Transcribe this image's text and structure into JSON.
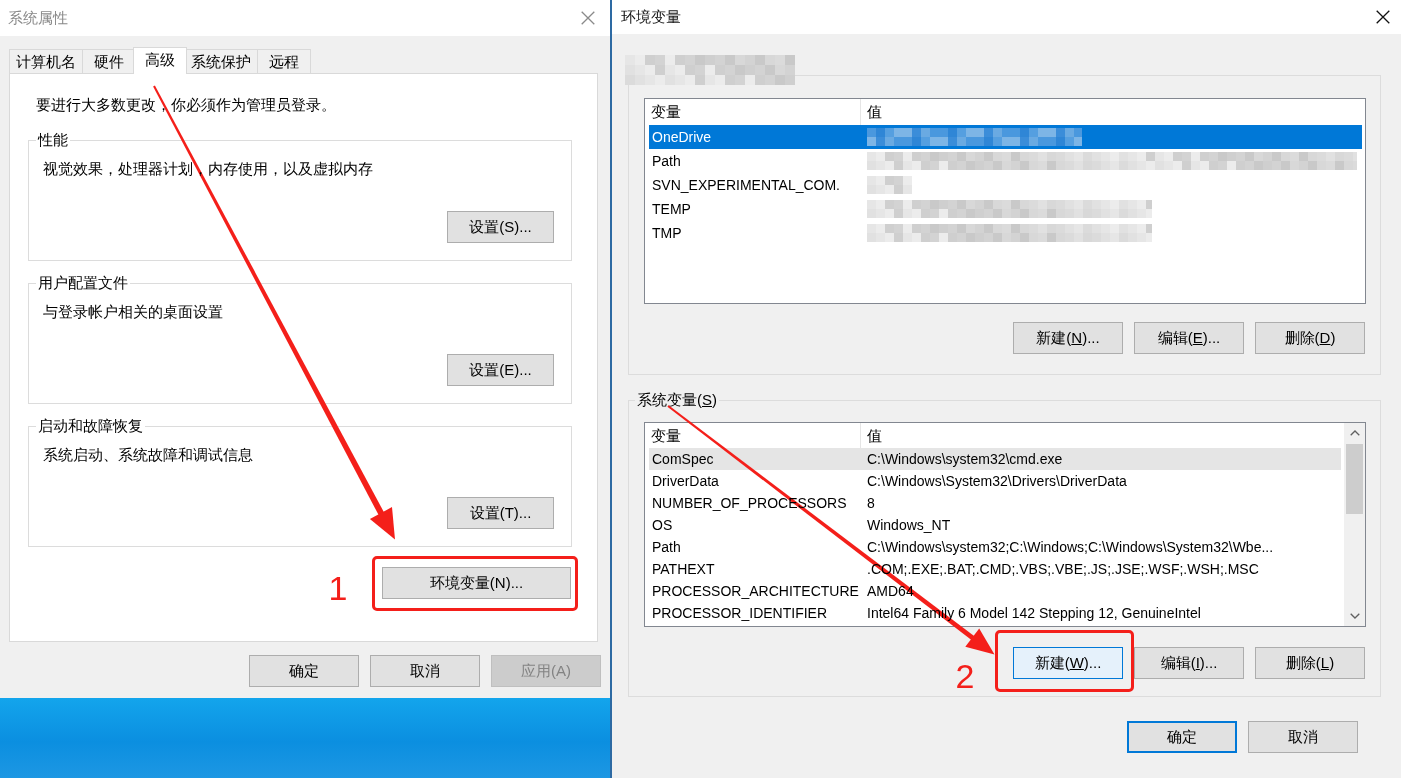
{
  "system_properties": {
    "title": "系统属性",
    "active": false,
    "tabs": [
      {
        "label": "计算机名",
        "selected": false
      },
      {
        "label": "硬件",
        "selected": false
      },
      {
        "label": "高级",
        "selected": true
      },
      {
        "label": "系统保护",
        "selected": false
      },
      {
        "label": "远程",
        "selected": false
      }
    ],
    "admin_notice": "要进行大多数更改，你必须作为管理员登录。",
    "groups": [
      {
        "title": "性能",
        "description": "视觉效果，处理器计划，内存使用，以及虚拟内存",
        "button": "设置(S)..."
      },
      {
        "title": "用户配置文件",
        "description": "与登录帐户相关的桌面设置",
        "button": "设置(E)..."
      },
      {
        "title": "启动和故障恢复",
        "description": "系统启动、系统故障和调试信息",
        "button": "设置(T)..."
      }
    ],
    "env_button": {
      "label": "环境变量(N)...",
      "callout": "1"
    },
    "buttons": [
      {
        "label": "确定",
        "disabled": false
      },
      {
        "label": "取消",
        "disabled": false
      },
      {
        "label": "应用(A)",
        "disabled": true
      }
    ]
  },
  "environment_variables": {
    "title": "环境变量",
    "active": true,
    "user_variables": {
      "legend_redacted": true,
      "focused": true,
      "columns": [
        "变量",
        "值"
      ],
      "rows": [
        {
          "name": "OneDrive",
          "value_redacted": true,
          "selected": true
        },
        {
          "name": "Path",
          "value_redacted": true,
          "selected": false
        },
        {
          "name": "SVN_EXPERIMENTAL_COM.",
          "value_redacted": true,
          "selected": false
        },
        {
          "name": "TEMP",
          "value_redacted": true,
          "selected": false
        },
        {
          "name": "TMP",
          "value_redacted": true,
          "selected": false
        }
      ],
      "buttons": [
        {
          "text": "新建(",
          "access_key": "N",
          "text_end": ")...",
          "hovered": false
        },
        {
          "text": "编辑(",
          "access_key": "E",
          "text_end": ")...",
          "hovered": false
        },
        {
          "text": "删除(",
          "access_key": "D",
          "text_end": ")",
          "hovered": false
        }
      ]
    },
    "system_variables": {
      "legend": {
        "text": "系统变量(",
        "access_key": "S",
        "text_end": ")"
      },
      "focused": false,
      "columns": [
        "变量",
        "值"
      ],
      "rows": [
        {
          "name": "ComSpec",
          "value": "C:\\Windows\\system32\\cmd.exe",
          "selected": true
        },
        {
          "name": "DriverData",
          "value": "C:\\Windows\\System32\\Drivers\\DriverData",
          "selected": false
        },
        {
          "name": "NUMBER_OF_PROCESSORS",
          "value": "8",
          "selected": false
        },
        {
          "name": "OS",
          "value": "Windows_NT",
          "selected": false
        },
        {
          "name": "Path",
          "value": "C:\\Windows\\system32;C:\\Windows;C:\\Windows\\System32\\Wbe...",
          "selected": false
        },
        {
          "name": "PATHEXT",
          "value": ".COM;.EXE;.BAT;.CMD;.VBS;.VBE;.JS;.JSE;.WSF;.WSH;.MSC",
          "selected": false
        },
        {
          "name": "PROCESSOR_ARCHITECTURE",
          "value": "AMD64",
          "selected": false
        },
        {
          "name": "PROCESSOR_IDENTIFIER",
          "value": "Intel64 Family 6 Model 142 Stepping 12, GenuineIntel",
          "selected": false
        }
      ],
      "buttons": [
        {
          "text": "新建(",
          "access_key": "W",
          "text_end": ")...",
          "hovered": true,
          "callout": "2"
        },
        {
          "text": "编辑(",
          "access_key": "I",
          "text_end": ")...",
          "hovered": false
        },
        {
          "text": "删除(",
          "access_key": "L",
          "text_end": ")",
          "hovered": false
        }
      ]
    },
    "buttons": [
      {
        "label": "确定",
        "default": true
      },
      {
        "label": "取消",
        "default": false
      }
    ]
  }
}
